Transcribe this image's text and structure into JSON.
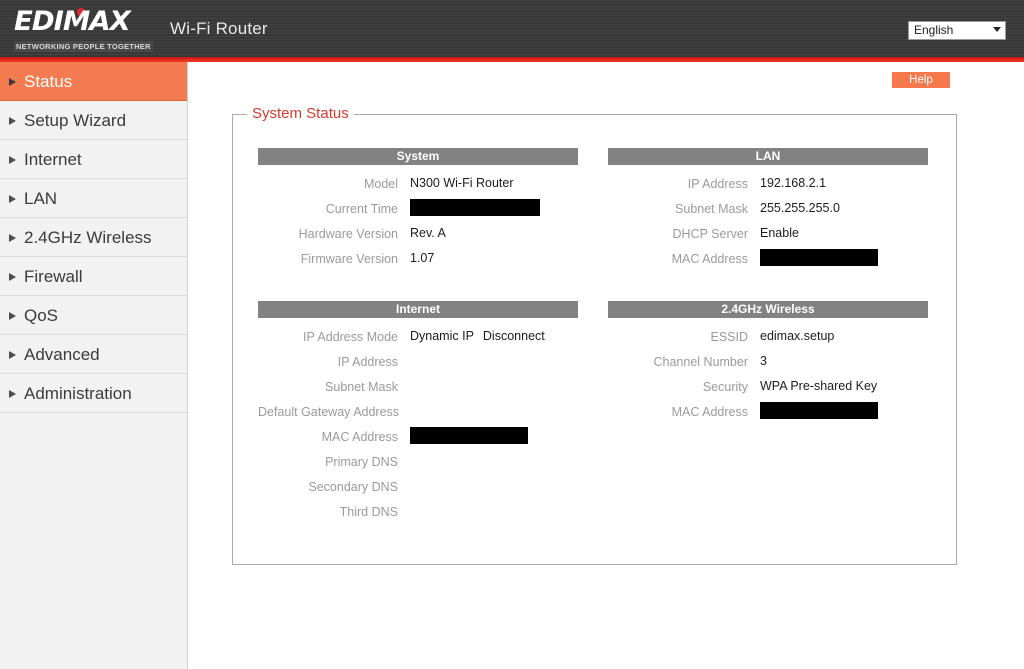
{
  "header": {
    "logo_word": "EDIMAX",
    "logo_tagline": "NETWORKING PEOPLE TOGETHER",
    "app_title": "Wi-Fi Router",
    "language_selected": "English",
    "accent_red": "#e5241c",
    "header_bg": "#3b3b3b"
  },
  "sidebar": {
    "active_color": "#f47b4f",
    "items": [
      {
        "label": "Status"
      },
      {
        "label": "Setup Wizard"
      },
      {
        "label": "Internet"
      },
      {
        "label": "LAN"
      },
      {
        "label": "2.4GHz Wireless"
      },
      {
        "label": "Firewall"
      },
      {
        "label": "QoS"
      },
      {
        "label": "Advanced"
      },
      {
        "label": "Administration"
      }
    ]
  },
  "content": {
    "help_label": "Help",
    "legend": "System Status",
    "panels": {
      "system": {
        "title": "System",
        "rows": [
          {
            "label": "Model",
            "value": "N300 Wi-Fi Router",
            "redacted": false
          },
          {
            "label": "Current Time",
            "value": "",
            "redacted": true
          },
          {
            "label": "Hardware Version",
            "value": "Rev. A",
            "redacted": false
          },
          {
            "label": "Firmware Version",
            "value": "1.07",
            "redacted": false
          }
        ]
      },
      "lan": {
        "title": "LAN",
        "rows": [
          {
            "label": "IP Address",
            "value": "192.168.2.1",
            "redacted": false
          },
          {
            "label": "Subnet Mask",
            "value": "255.255.255.0",
            "redacted": false
          },
          {
            "label": "DHCP Server",
            "value": "Enable",
            "redacted": false
          },
          {
            "label": "MAC Address",
            "value": "",
            "redacted": true
          }
        ]
      },
      "internet": {
        "title": "Internet",
        "mode_label": "IP Address Mode",
        "mode_value": "Dynamic IP",
        "disconnect_label": "Disconnect",
        "rows": [
          {
            "label": "IP Address",
            "value": "",
            "redacted": false
          },
          {
            "label": "Subnet Mask",
            "value": "",
            "redacted": false
          },
          {
            "label": "Default Gateway Address",
            "value": "",
            "redacted": false
          },
          {
            "label": "MAC Address",
            "value": "",
            "redacted": true
          },
          {
            "label": "Primary DNS",
            "value": "",
            "redacted": false
          },
          {
            "label": "Secondary DNS",
            "value": "",
            "redacted": false
          },
          {
            "label": "Third DNS",
            "value": "",
            "redacted": false
          }
        ]
      },
      "wireless": {
        "title": "2.4GHz  Wireless",
        "rows": [
          {
            "label": "ESSID",
            "value": "edimax.setup",
            "redacted": false
          },
          {
            "label": "Channel Number",
            "value": "3",
            "redacted": false
          },
          {
            "label": "Security",
            "value": "WPA Pre-shared Key",
            "redacted": false
          },
          {
            "label": "MAC Address",
            "value": "",
            "redacted": true
          }
        ]
      }
    }
  }
}
